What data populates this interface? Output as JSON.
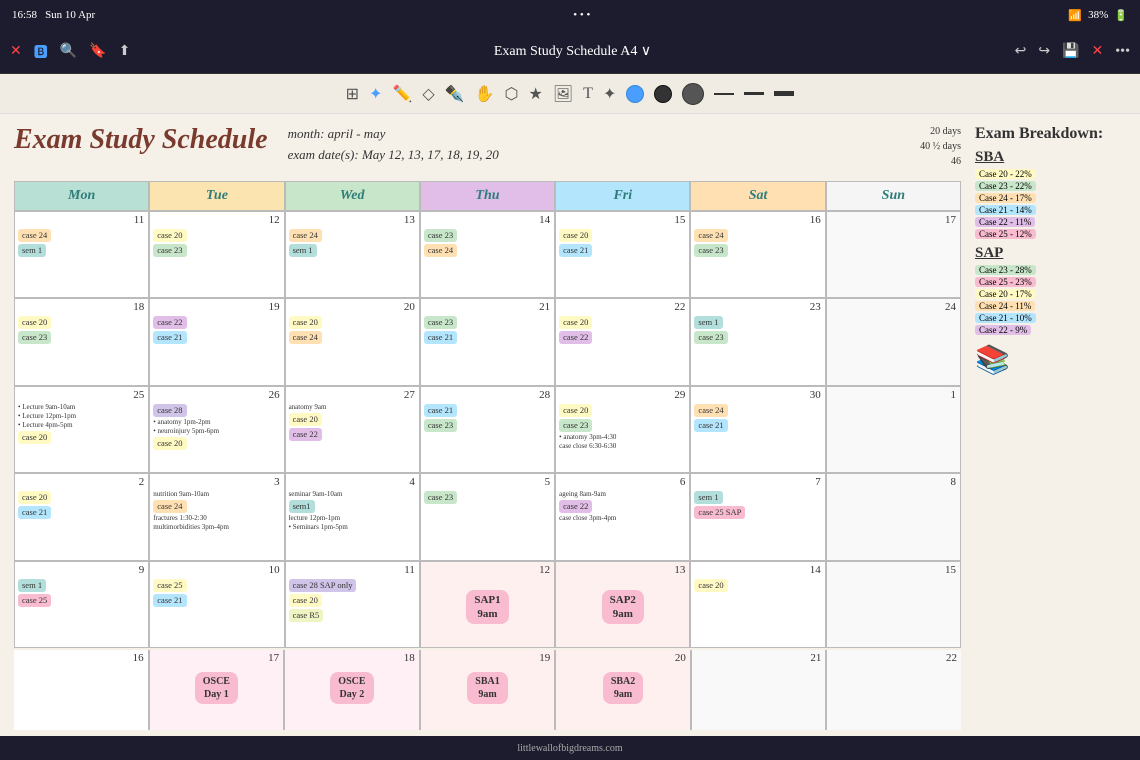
{
  "statusBar": {
    "time": "16:58",
    "date": "Sun 10 Apr",
    "wifi": "●",
    "battery": "38%"
  },
  "toolbar": {
    "title": "Exam Study Schedule A4 ∨",
    "closeLabel": "✕",
    "backLabel": "⟵",
    "forwardLabel": "⟶"
  },
  "schedule": {
    "title": "Exam Study Schedule",
    "monthLabel": "month: april - may",
    "examDatesLabel": "exam date(s): May 12, 13, 17, 18, 19, 20",
    "stats": {
      "days": "20 days",
      "halfDays": "40 ½ days",
      "count": "46"
    }
  },
  "days": [
    "Mon",
    "Tue",
    "Wed",
    "Thu",
    "Fri",
    "Sat",
    "Sun"
  ],
  "breakdown": {
    "title": "Exam Breakdown:",
    "sba": {
      "title": "SBA",
      "items": [
        {
          "label": "Case 20 - 22%",
          "color": "tag-yellow"
        },
        {
          "label": "Case 23 - 22%",
          "color": "tag-green"
        },
        {
          "label": "Case 24 - 17%",
          "color": "tag-orange"
        },
        {
          "label": "Case 21 - 14%",
          "color": "tag-blue"
        },
        {
          "label": "Case 22 - 11%",
          "color": "tag-purple"
        },
        {
          "label": "Case 25 - 12%",
          "color": "tag-pink"
        }
      ]
    },
    "sap": {
      "title": "SAP",
      "items": [
        {
          "label": "Case 23 - 28%",
          "color": "tag-green"
        },
        {
          "label": "Case 25 - 23%",
          "color": "tag-pink"
        },
        {
          "label": "Case 20 - 17%",
          "color": "tag-yellow"
        },
        {
          "label": "Case 24 - 11%",
          "color": "tag-orange"
        },
        {
          "label": "Case 21 - 10%",
          "color": "tag-blue"
        },
        {
          "label": "Case 22 - 9%",
          "color": "tag-purple"
        }
      ]
    }
  },
  "bottomBar": {
    "website": "littlewallofbigdreams.com"
  }
}
